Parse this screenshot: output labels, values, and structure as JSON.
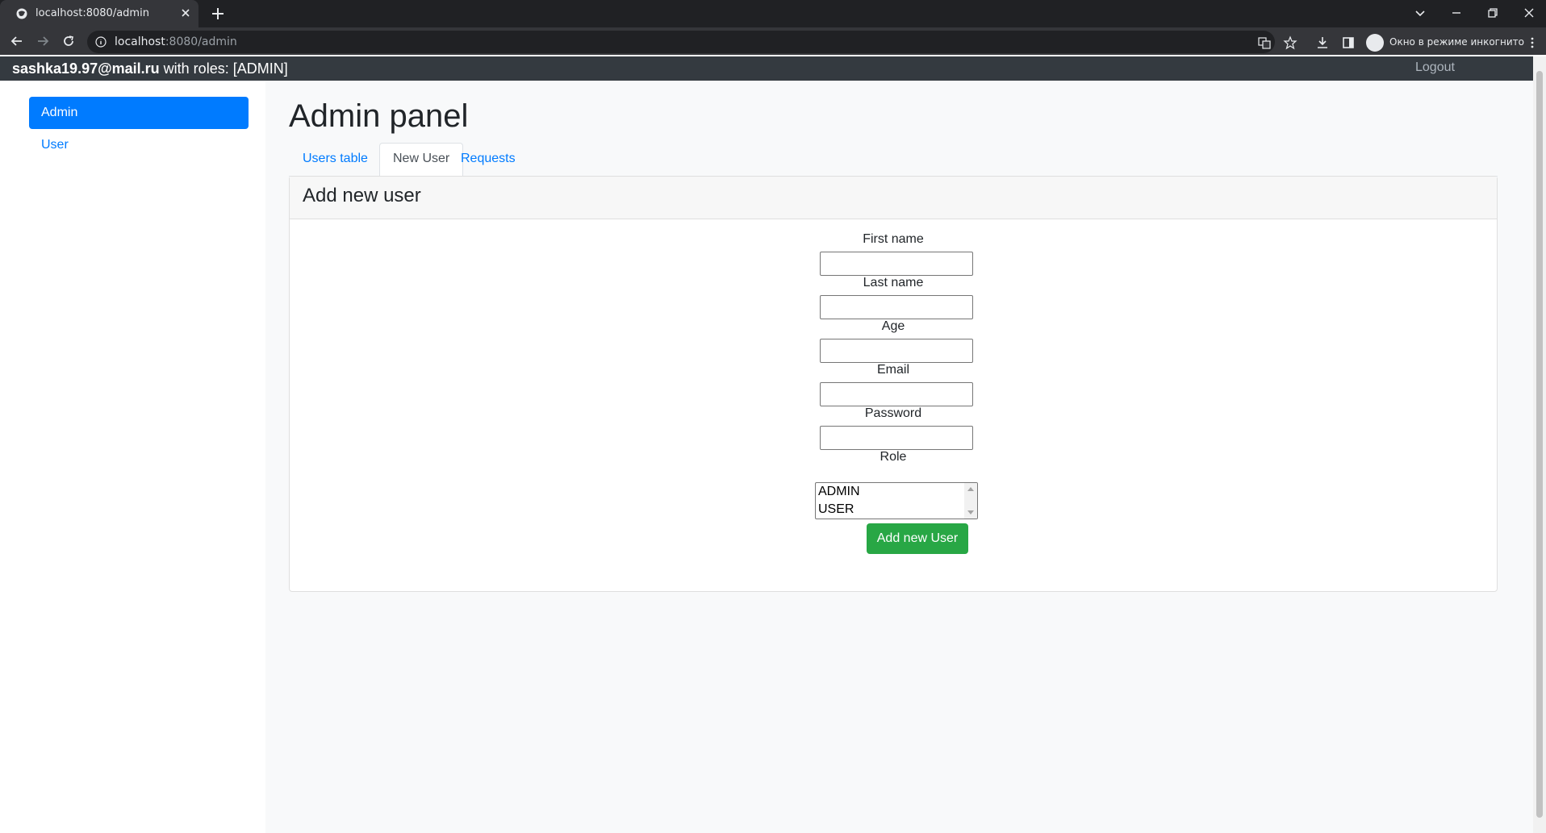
{
  "browser": {
    "tab_title": "localhost:8080/admin",
    "url_host": "localhost",
    "url_rest": ":8080/admin",
    "incognito_label": "Окно в режиме инкогнито"
  },
  "navbar": {
    "user_email": "sashka19.97@mail.ru",
    "roles_text": " with roles: [ADMIN]",
    "logout_label": "Logout"
  },
  "sidebar": {
    "items": [
      {
        "label": "Admin",
        "active": true
      },
      {
        "label": "User",
        "active": false
      }
    ]
  },
  "main": {
    "title": "Admin panel",
    "tabs": [
      {
        "label": "Users table",
        "active": false
      },
      {
        "label": "New User",
        "active": true
      },
      {
        "label": "Requests",
        "active": false
      }
    ],
    "card": {
      "title": "Add new user",
      "fields": {
        "first_name": {
          "label": "First name",
          "value": ""
        },
        "last_name": {
          "label": "Last name",
          "value": ""
        },
        "age": {
          "label": "Age",
          "value": ""
        },
        "email": {
          "label": "Email",
          "value": ""
        },
        "password": {
          "label": "Password",
          "value": ""
        }
      },
      "role": {
        "label": "Role",
        "options": [
          "ADMIN",
          "USER"
        ]
      },
      "submit_label": "Add new User"
    }
  },
  "colors": {
    "primary": "#007bff",
    "success": "#28a745",
    "navbar": "#343a40",
    "chrome_dark": "#202124"
  }
}
